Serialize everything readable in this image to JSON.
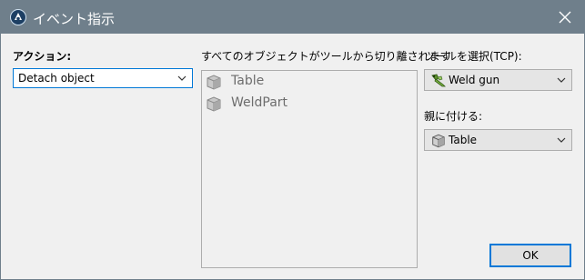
{
  "window": {
    "title": "イベント指示",
    "close_icon": "close-icon",
    "app_icon": "app-logo-icon"
  },
  "action": {
    "label": "アクション:",
    "value": "Detach object"
  },
  "objects": {
    "label": "すべてのオブジェクトがツールから切り離されます",
    "items": [
      {
        "label": "Table",
        "icon": "cube-icon"
      },
      {
        "label": "WeldPart",
        "icon": "cube-icon"
      }
    ]
  },
  "tool": {
    "label": "ツールを選択(TCP):",
    "value": "Weld gun",
    "icon": "weld-gun-icon"
  },
  "parent": {
    "label": "親に付ける:",
    "value": "Table",
    "icon": "cube-icon"
  },
  "buttons": {
    "ok": "OK"
  },
  "colors": {
    "titlebar": "#6f7f8b",
    "accent": "#0078d7",
    "background": "#f0f0f0"
  }
}
